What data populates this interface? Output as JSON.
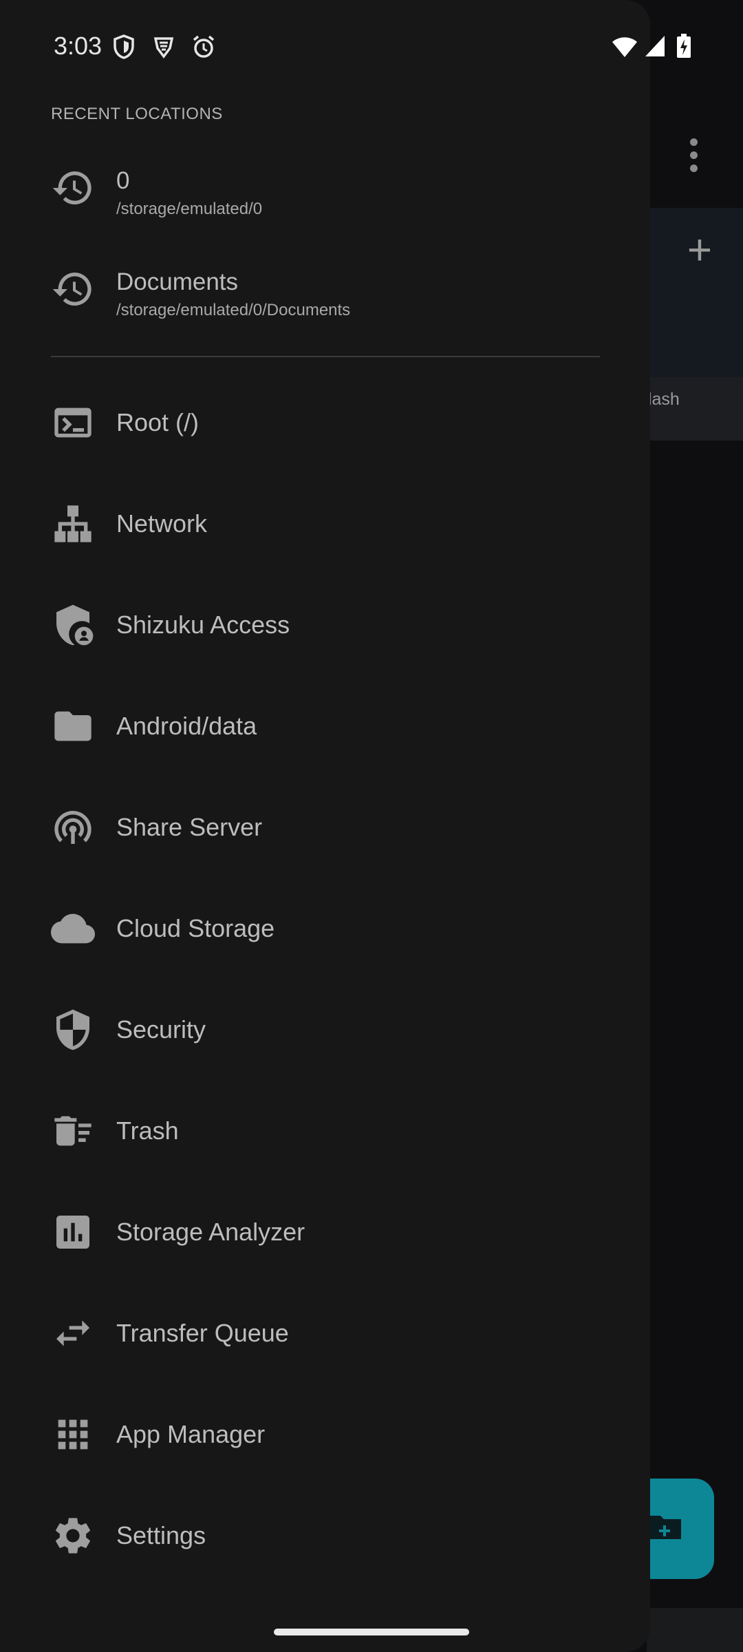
{
  "status_bar": {
    "time": "3:03",
    "notification_icons": [
      "vpn-shield-icon",
      "brave-icon",
      "alarm-icon"
    ],
    "system_icons": [
      "wifi-icon",
      "signal-icon",
      "battery-charging-icon"
    ]
  },
  "drawer": {
    "recent_header": "RECENT LOCATIONS",
    "recent_locations": [
      {
        "title": "0",
        "path": "/storage/emulated/0",
        "icon": "history-icon"
      },
      {
        "title": "Documents",
        "path": "/storage/emulated/0/Documents",
        "icon": "history-icon"
      }
    ],
    "items": [
      {
        "label": "Root (/)",
        "icon": "terminal-icon"
      },
      {
        "label": "Network",
        "icon": "network-icon"
      },
      {
        "label": "Shizuku Access",
        "icon": "shield-user-icon"
      },
      {
        "label": "Android/data",
        "icon": "folder-icon"
      },
      {
        "label": "Share Server",
        "icon": "broadcast-icon"
      },
      {
        "label": "Cloud Storage",
        "icon": "cloud-icon"
      },
      {
        "label": "Security",
        "icon": "security-shield-icon"
      },
      {
        "label": "Trash",
        "icon": "trash-icon"
      },
      {
        "label": "Storage Analyzer",
        "icon": "bar-chart-icon"
      },
      {
        "label": "Transfer Queue",
        "icon": "swap-arrows-icon"
      },
      {
        "label": "App Manager",
        "icon": "grid-icon"
      },
      {
        "label": "Settings",
        "icon": "gear-icon"
      }
    ]
  },
  "background": {
    "chip_label": "flash",
    "accent_color": "#0d8796"
  }
}
